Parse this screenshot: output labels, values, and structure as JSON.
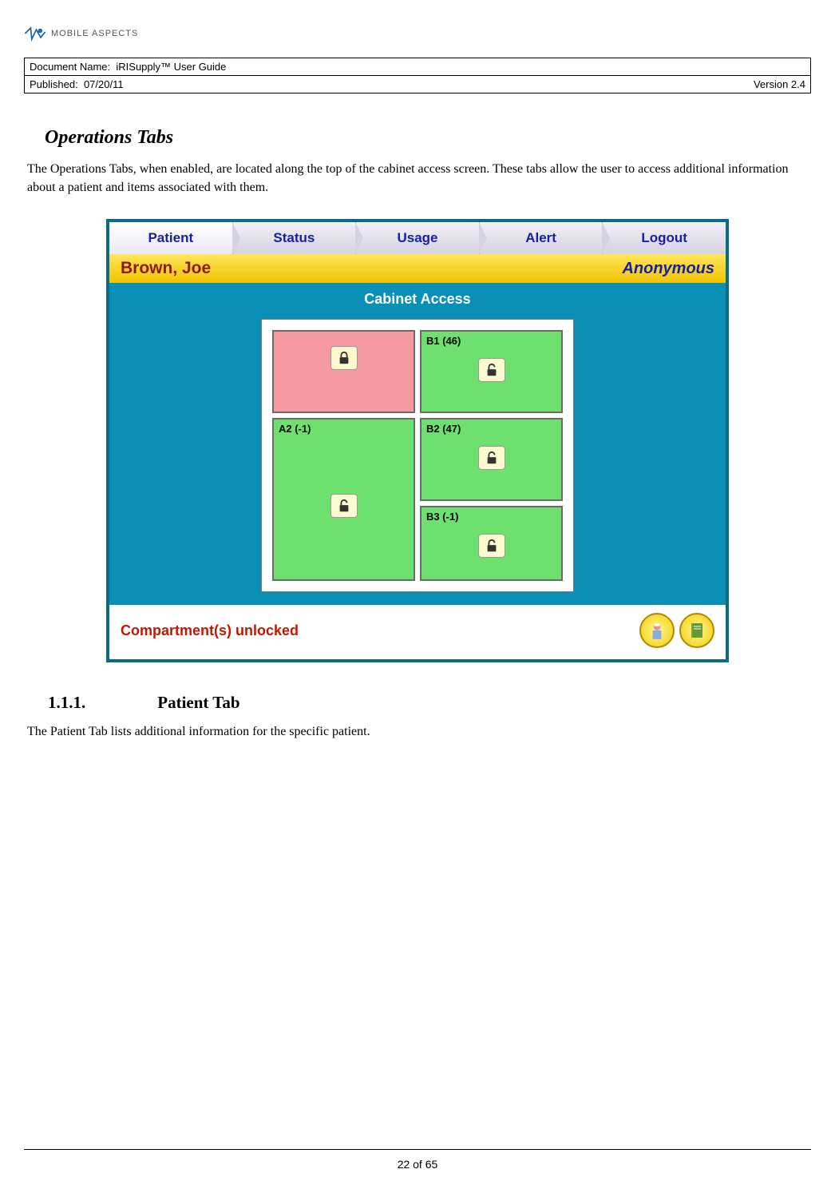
{
  "logo": {
    "text": "MOBILE ASPECTS"
  },
  "meta": {
    "doc_label": "Document Name:",
    "doc_value": "iRISupply™ User Guide",
    "pub_label": "Published:",
    "pub_value": "07/20/11",
    "version": "Version 2.4"
  },
  "section": {
    "heading": "Operations Tabs",
    "para": "The Operations Tabs, when enabled, are located along the top of the cabinet access screen.  These tabs allow the user to access additional information about a patient and items associated with them."
  },
  "app": {
    "tabs": [
      "Patient",
      "Status",
      "Usage",
      "Alert",
      "Logout"
    ],
    "active_tab_index": 0,
    "patient_name": "Brown, Joe",
    "anon_label": "Anonymous",
    "panel_title": "Cabinet Access",
    "compartments": {
      "a1": {
        "label": "",
        "locked": true
      },
      "b1": {
        "label": "B1 (46)",
        "locked": false
      },
      "a2": {
        "label": "A2 (-1)",
        "locked": false
      },
      "b2": {
        "label": "B2 (47)",
        "locked": false
      },
      "b3": {
        "label": "B3 (-1)",
        "locked": false
      }
    },
    "status_text": "Compartment(s) unlocked"
  },
  "subsection": {
    "number": "1.1.1.",
    "title": "Patient Tab",
    "para": "The Patient Tab lists additional information for the specific patient."
  },
  "footer": {
    "page": "22 of 65"
  }
}
